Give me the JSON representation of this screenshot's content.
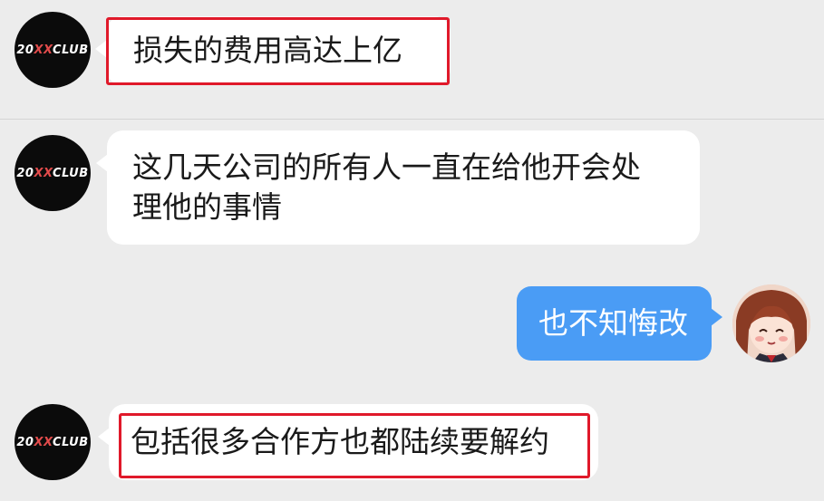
{
  "messages": [
    {
      "sender": "club",
      "avatar_logo": {
        "part1": "20",
        "part2": "XX",
        "part3": "CLUB"
      },
      "text": "损失的费用高达上亿",
      "highlighted": true
    },
    {
      "sender": "club",
      "avatar_logo": {
        "part1": "20",
        "part2": "XX",
        "part3": "CLUB"
      },
      "text_line1": "这几天公司的所有人一直在给他开会处",
      "text_line2": "理他的事情",
      "highlighted": false
    },
    {
      "sender": "self",
      "text": "也不知悔改",
      "highlighted": false
    },
    {
      "sender": "club",
      "avatar_logo": {
        "part1": "20",
        "part2": "XX",
        "part3": "CLUB"
      },
      "text": "包括很多合作方也都陆续要解约",
      "highlighted": true
    }
  ],
  "colors": {
    "background": "#ececec",
    "incoming_bubble": "#ffffff",
    "outgoing_bubble": "#4a9cf5",
    "highlight_box": "#e0192a",
    "avatar_bg": "#0b0b0b"
  },
  "icons": {
    "club_avatar": "club-logo-avatar",
    "user_avatar": "anime-girl-avatar"
  }
}
